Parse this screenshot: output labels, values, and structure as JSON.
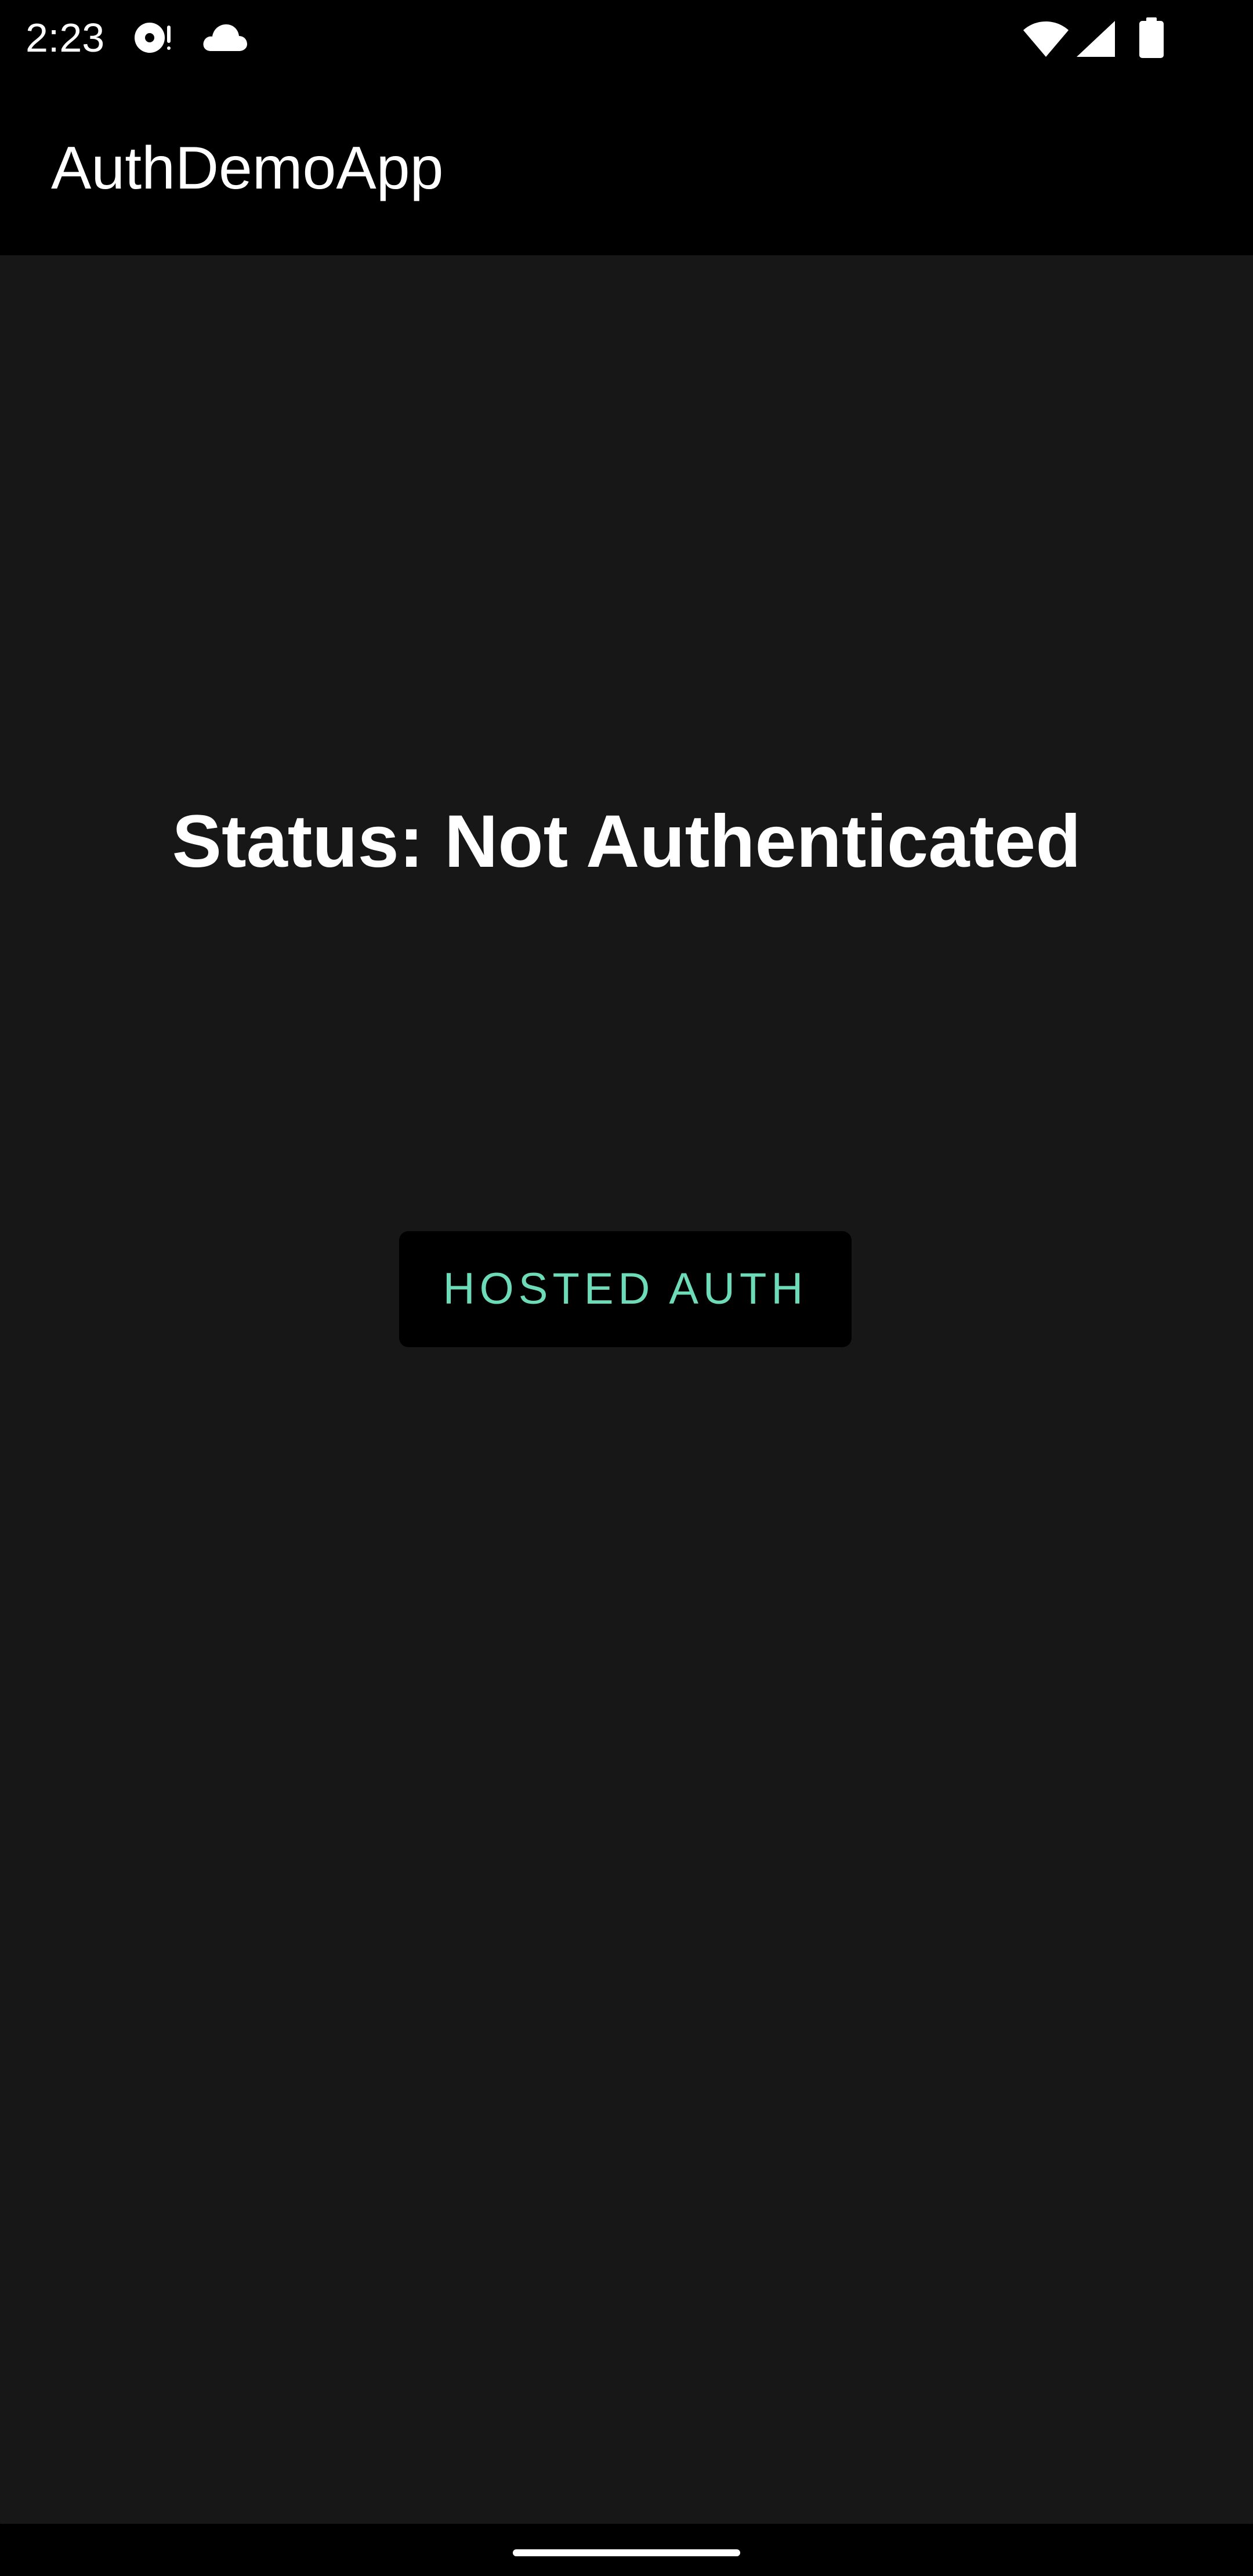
{
  "status_bar": {
    "time": "2:23",
    "icons_left": [
      "media-cast-icon",
      "cloud-icon"
    ],
    "icons_right": [
      "wifi-icon",
      "cellular-signal-icon",
      "battery-icon"
    ]
  },
  "app_bar": {
    "title": "AuthDemoApp"
  },
  "main": {
    "status_text": "Status: Not Authenticated",
    "hosted_auth_button_label": "HOSTED AUTH"
  },
  "colors": {
    "background": "#171717",
    "bars": "#000000",
    "button_text": "#6edbb8",
    "text": "#ffffff"
  }
}
